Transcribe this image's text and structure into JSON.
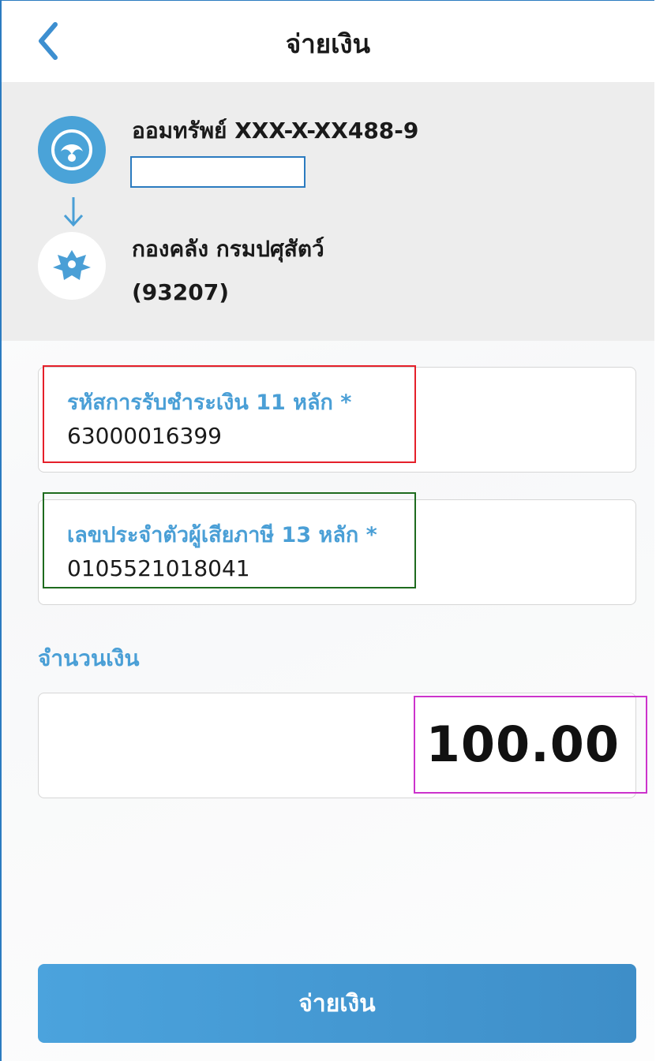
{
  "header": {
    "title": "จ่ายเงิน",
    "back_icon": "chevron-left-icon"
  },
  "source_account": {
    "name": "ออมทรัพย์ XXX-X-XX488-9",
    "icon": "bank-logo-icon"
  },
  "payee": {
    "name": "กองคลัง กรมปศุสัตว์",
    "code": "(93207)",
    "icon": "garuda-emblem-icon"
  },
  "fields": [
    {
      "label": "รหัสการรับชำระเงิน 11 หลัก *",
      "value": "63000016399"
    },
    {
      "label": "เลขประจำตัวผู้เสียภาษี 13 หลัก *",
      "value": "0105521018041"
    }
  ],
  "amount": {
    "label": "จำนวนเงิน",
    "value": "100.00"
  },
  "pay_button": {
    "label": "จ่ายเงิน"
  },
  "colors": {
    "accent": "#4a9fd6",
    "button": "#3e8ec8",
    "panel": "#ededed"
  }
}
